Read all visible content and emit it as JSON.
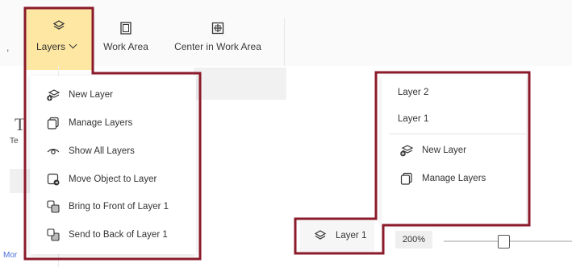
{
  "toolbar": {
    "layers_label": "Layers",
    "work_area_label": "Work Area",
    "center_label": "Center in Work Area"
  },
  "layers_menu": {
    "items": [
      {
        "label": "New Layer",
        "icon": "new-layer-icon"
      },
      {
        "label": "Manage Layers",
        "icon": "manage-layers-icon"
      },
      {
        "label": "Show All Layers",
        "icon": "eye-icon"
      },
      {
        "label": "Move Object to Layer",
        "icon": "move-object-icon"
      },
      {
        "label": "Bring to Front of Layer 1",
        "icon": "bring-front-icon"
      },
      {
        "label": "Send to Back of Layer 1",
        "icon": "send-back-icon"
      }
    ]
  },
  "layer_popup": {
    "layers": [
      "Layer 2",
      "Layer 1"
    ],
    "actions": [
      {
        "label": "New Layer",
        "icon": "new-layer-icon"
      },
      {
        "label": "Manage Layers",
        "icon": "manage-layers-icon"
      }
    ]
  },
  "status": {
    "current_layer": "Layer 1",
    "zoom": "200%",
    "zoom_slider_fraction": 0.47
  },
  "canvas": {
    "partial_heading": "T",
    "partial_label": "Te",
    "partial_link": "Mor"
  },
  "colors": {
    "highlight_outline": "#8b1a2b",
    "active_tab": "#fde7a2"
  }
}
